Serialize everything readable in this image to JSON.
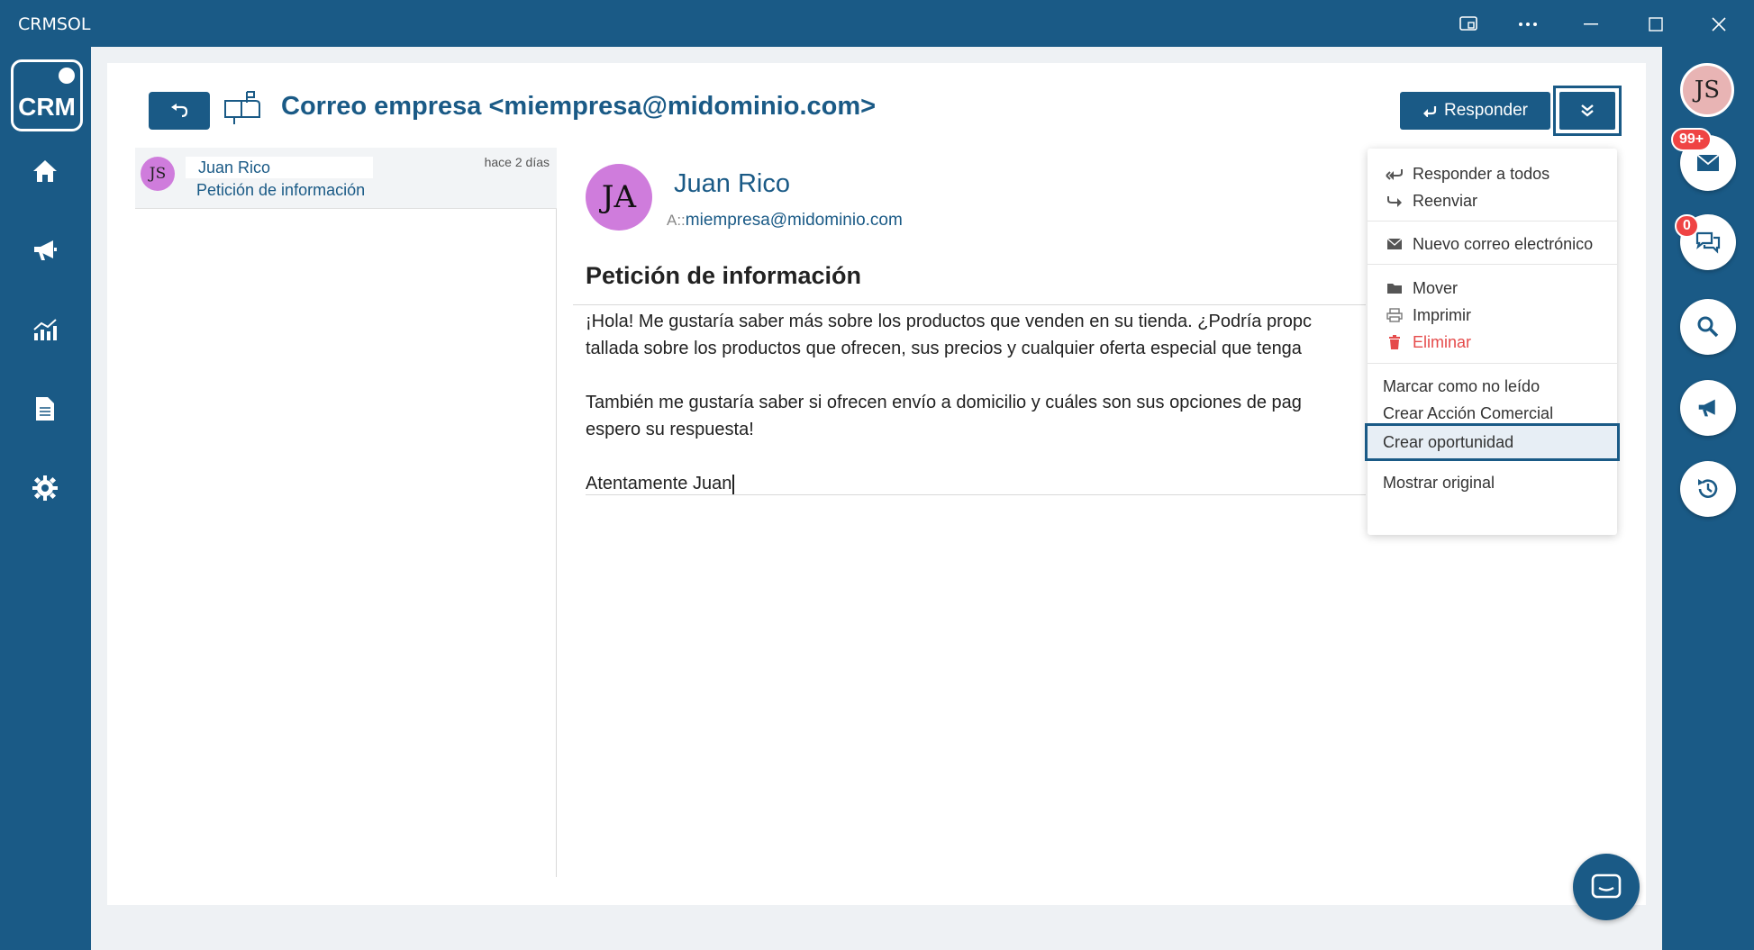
{
  "window": {
    "title": "CRMSOL"
  },
  "sidebar": {
    "logo_text": "CRM",
    "items": [
      {
        "name": "home"
      },
      {
        "name": "campaigns"
      },
      {
        "name": "reports"
      },
      {
        "name": "documents"
      },
      {
        "name": "settings"
      }
    ]
  },
  "header": {
    "title": "Correo empresa <miempresa@midominio.com>",
    "reply_label": "Responder"
  },
  "message_list": [
    {
      "avatar": "JS",
      "from": "Juan Rico",
      "subject": "Petición de información",
      "time": "hace 2 días"
    }
  ],
  "message": {
    "avatar": "JA",
    "sender": "Juan Rico",
    "to_label": "A::",
    "to_address": "miempresa@midominio.com",
    "subject": "Petición de información",
    "body_lines": [
      "¡Hola! Me gustaría saber más sobre los productos que venden en su tienda. ¿Podría propc",
      "tallada sobre los productos que ofrecen, sus precios y cualquier oferta especial que tenga",
      "También me gustaría saber si ofrecen envío a domicilio y cuáles son sus opciones de pag",
      "espero su respuesta!",
      "Atentamente Juan"
    ]
  },
  "dropdown": {
    "items": [
      {
        "label": "Responder a todos",
        "icon": "reply-all-icon"
      },
      {
        "label": "Reenviar",
        "icon": "forward-icon"
      },
      {
        "label": "Nuevo correo electrónico",
        "icon": "envelope-icon"
      },
      {
        "label": "Mover",
        "icon": "folder-icon"
      },
      {
        "label": "Imprimir",
        "icon": "printer-icon"
      },
      {
        "label": "Eliminar",
        "icon": "trash-icon"
      },
      {
        "label": "Marcar como no leído"
      },
      {
        "label": "Crear Acción Comercial"
      },
      {
        "label": "Crear oportunidad",
        "selected": true
      },
      {
        "label": "Mostrar original"
      }
    ]
  },
  "right_rail": {
    "avatar": "JS",
    "mail_badge": "99+",
    "chat_badge": "0"
  },
  "colors": {
    "brand": "#1a5a86",
    "danger": "#e54b4b",
    "badge": "#ef4444",
    "avatar_purple": "#cf7cdc",
    "avatar_pink": "#e8b4b4"
  }
}
